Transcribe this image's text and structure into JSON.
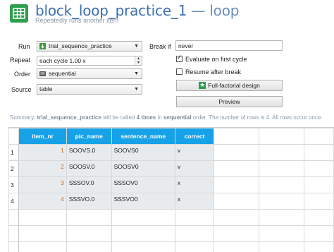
{
  "header": {
    "name": "block_loop_practice_1",
    "separator": " — ",
    "type": "loop",
    "subtitle": "Repeatedly runs another item"
  },
  "form": {
    "run_label": "Run",
    "run_value": "trial_sequence_practice",
    "repeat_label": "Repeat",
    "repeat_value": "each cycle 1.00 x",
    "order_label": "Order",
    "order_value": "sequential",
    "source_label": "Source",
    "source_value": "table",
    "break_if_label": "Break if",
    "break_if_value": "never",
    "evaluate_first_label": "Evaluate on first cycle",
    "evaluate_first_checked": true,
    "resume_after_break_label": "Resume after break",
    "resume_after_break_checked": false,
    "full_factorial_label": "Full-factorial design",
    "preview_label": "Preview"
  },
  "summary": {
    "prefix": "Summary: ",
    "item": "trial_sequence_practice",
    "mid1": " will be called ",
    "times": "4 times",
    "mid2": " in ",
    "order": "sequential",
    "suffix": " order. The number of rows is 4. All rows occur once."
  },
  "table": {
    "columns": [
      "item_nr",
      "pic_name",
      "sentence_name",
      "correct"
    ],
    "rows": [
      {
        "num": "1",
        "cells": [
          "1",
          "SOOVS.0",
          "SOOVS0",
          "v"
        ]
      },
      {
        "num": "2",
        "cells": [
          "2",
          "SOOSV.0",
          "SOOSV0",
          "v"
        ]
      },
      {
        "num": "3",
        "cells": [
          "3",
          "SSSOV.0",
          "SSSOV0",
          "x"
        ]
      },
      {
        "num": "4",
        "cells": [
          "4",
          "SSSVO.0",
          "SSSVO0",
          "x"
        ]
      }
    ]
  },
  "colors": {
    "title": "#3b6fb0",
    "header_cell": "#17a2e8",
    "app_icon": "#2e9e4d",
    "number_text": "#d06a1a"
  },
  "icons": [
    "loop-table-icon",
    "run-item-icon",
    "sequential-order-icon",
    "full-factorial-icon",
    "combo-arrow-icon",
    "spin-arrows-icon",
    "checkmark-icon"
  ]
}
